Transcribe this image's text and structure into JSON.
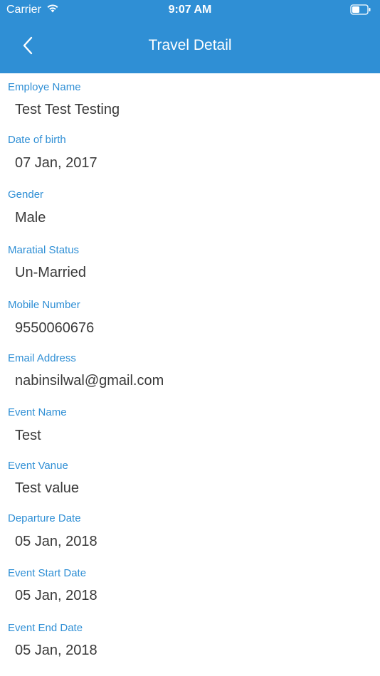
{
  "status_bar": {
    "carrier": "Carrier",
    "time": "9:07 AM",
    "wifi_icon": "wifi-icon",
    "battery_icon": "battery-icon"
  },
  "nav": {
    "title": "Travel Detail",
    "back_icon": "chevron-left-icon"
  },
  "colors": {
    "header_bg": "#2f8fd5",
    "label": "#2f8fd5",
    "value": "#3a3a3a"
  },
  "fields": [
    {
      "label": "Employe Name",
      "value": "Test Test Testing"
    },
    {
      "label": "Date of birth",
      "value": "07 Jan, 2017"
    },
    {
      "label": "Gender",
      "value": "Male"
    },
    {
      "label": "Maratial Status",
      "value": "Un-Married"
    },
    {
      "label": "Mobile Number",
      "value": "9550060676"
    },
    {
      "label": "Email Address",
      "value": "nabinsilwal@gmail.com"
    },
    {
      "label": "Event Name",
      "value": "Test"
    },
    {
      "label": "Event Vanue",
      "value": "Test value"
    },
    {
      "label": "Departure Date",
      "value": "05 Jan, 2018"
    },
    {
      "label": "Event Start Date",
      "value": "05 Jan, 2018"
    },
    {
      "label": "Event End Date",
      "value": "05 Jan, 2018"
    }
  ]
}
